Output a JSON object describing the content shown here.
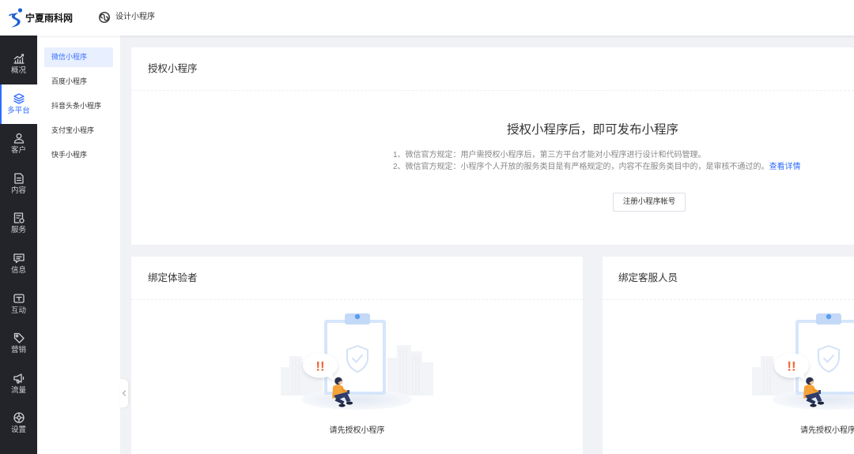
{
  "header": {
    "logo_text": "宁夏雨科网",
    "logo_icon": "brand-logo-icon",
    "section_icon": "mini-program-icon",
    "section_title": "设计小程序"
  },
  "sidebar": {
    "active_index": 1,
    "items": [
      {
        "label": "概况",
        "icon": "chart-icon"
      },
      {
        "label": "多平台",
        "icon": "layers-icon"
      },
      {
        "label": "客户",
        "icon": "user-icon"
      },
      {
        "label": "内容",
        "icon": "document-icon"
      },
      {
        "label": "服务",
        "icon": "service-icon"
      },
      {
        "label": "信息",
        "icon": "message-icon"
      },
      {
        "label": "互动",
        "icon": "interaction-icon"
      },
      {
        "label": "营销",
        "icon": "tag-icon"
      },
      {
        "label": "流量",
        "icon": "megaphone-icon"
      },
      {
        "label": "设置",
        "icon": "settings-icon"
      }
    ]
  },
  "subnav": {
    "active_index": 0,
    "items": [
      {
        "label": "微信小程序"
      },
      {
        "label": "百度小程序"
      },
      {
        "label": "抖音头条小程序"
      },
      {
        "label": "支付宝小程序"
      },
      {
        "label": "快手小程序"
      }
    ],
    "collapse_icon": "chevron-left-icon"
  },
  "authorize_card": {
    "title": "授权小程序",
    "heading": "授权小程序后，即可发布小程序",
    "notes": [
      "1、微信官方规定：用户需授权小程序后，第三方平台才能对小程序进行设计和代码管理。",
      "2、微信官方规定：小程序个人开放的服务类目是有严格规定的，内容不在服务类目中的，是审核不通过的。"
    ],
    "details_link": "查看详情",
    "register_button": "注册小程序帐号"
  },
  "testers_card": {
    "title": "绑定体验者",
    "empty_text": "请先授权小程序"
  },
  "service_card": {
    "title": "绑定客服人员",
    "empty_text": "请先授权小程序"
  },
  "empty_state": {
    "illustration": "empty-state-illustration",
    "illustration_mark": "!!"
  },
  "colors": {
    "accent": "#2f6bff",
    "sidebar_bg": "#222429",
    "page_bg": "#f0f2f5",
    "alert": "#f06a35",
    "brand_blue": "#1c5fd4"
  }
}
